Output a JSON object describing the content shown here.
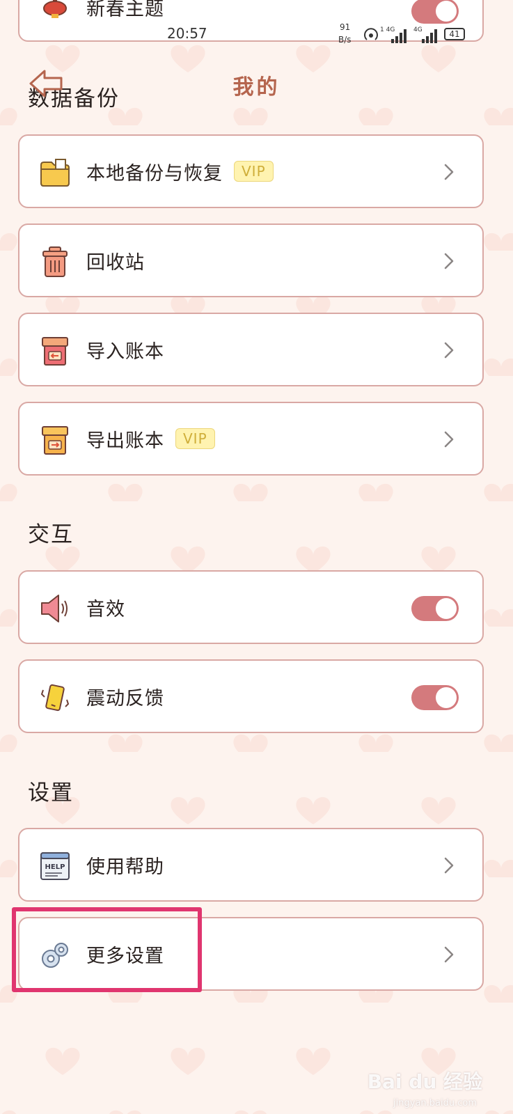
{
  "statusbar": {
    "time": "20:57",
    "net_speed_value": "91",
    "net_speed_unit": "B/s",
    "signal_1": "1 4G",
    "signal_2": "4G",
    "battery": "41"
  },
  "header": {
    "title": "我的",
    "top_item_label": "新春主题"
  },
  "sections": {
    "backup": "数据备份",
    "interaction": "交互",
    "settings": "设置"
  },
  "items": {
    "local_backup": {
      "label": "本地备份与恢复",
      "badge": "VIP",
      "icon": "folder-icon"
    },
    "recycle_bin": {
      "label": "回收站",
      "icon": "trash-icon"
    },
    "import_book": {
      "label": "导入账本",
      "icon": "import-box-icon"
    },
    "export_book": {
      "label": "导出账本",
      "badge": "VIP",
      "icon": "export-box-icon"
    },
    "sound": {
      "label": "音效",
      "icon": "speaker-icon",
      "toggle_on": true
    },
    "vibration": {
      "label": "震动反馈",
      "icon": "vibrate-phone-icon",
      "toggle_on": true
    },
    "help": {
      "label": "使用帮助",
      "icon": "help-doc-icon",
      "icon_text": "HELP"
    },
    "more_settings": {
      "label": "更多设置",
      "icon": "gear-icon"
    }
  },
  "watermark": {
    "brand": "Bai du 经验",
    "url": "jingyan.baidu.com"
  },
  "colors": {
    "accent": "#d47a7d",
    "card_border": "#d9a8a4",
    "highlight": "#e0356f",
    "title": "#b5654e",
    "background": "#fdf3ee"
  }
}
